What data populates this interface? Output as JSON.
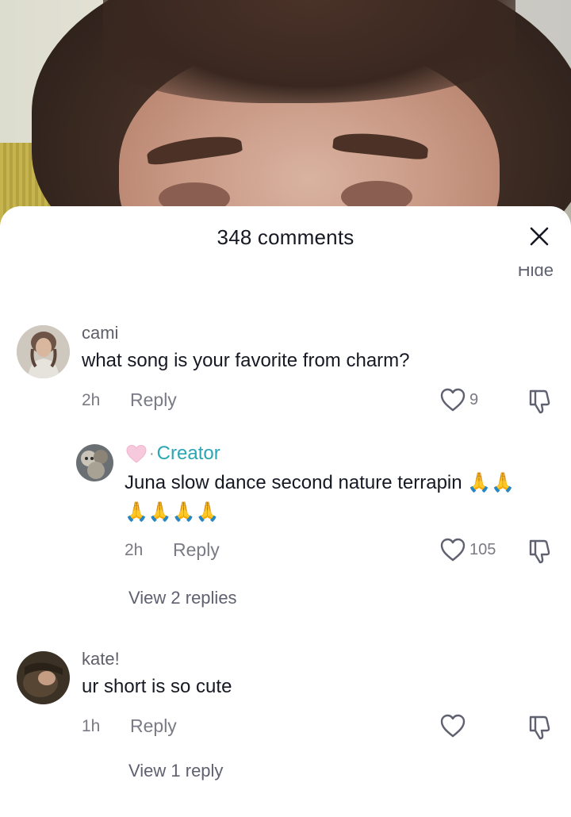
{
  "sheet": {
    "title": "348 comments",
    "hide_peek": "Hide"
  },
  "comments": [
    {
      "username": "cami",
      "text": "what song is your favorite from charm?",
      "time": "2h",
      "reply_label": "Reply",
      "likes": "9",
      "reply": {
        "badge_label": "Creator",
        "text_line1": "Juna slow dance second nature terrapin 🙏🙏",
        "text_line2": "🙏🙏🙏🙏",
        "time": "2h",
        "reply_label": "Reply",
        "likes": "105"
      },
      "view_replies": "View 2 replies"
    },
    {
      "username": "kate!",
      "text": "ur short is so cute",
      "time": "1h",
      "reply_label": "Reply",
      "view_replies": "View 1 reply"
    }
  ]
}
